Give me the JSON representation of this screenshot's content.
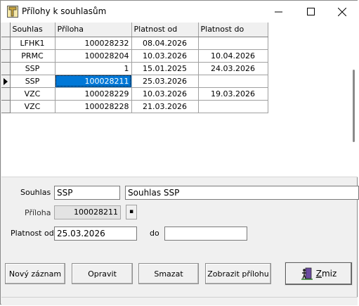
{
  "window": {
    "title": "Přílohy k souhlasům"
  },
  "grid": {
    "headers": [
      "Souhlas",
      "Příloha",
      "Platnost od",
      "Platnost do"
    ],
    "rows": [
      {
        "souhlas": "LFHK1",
        "priloha": "100028232",
        "od": "08.04.2026",
        "do": ""
      },
      {
        "souhlas": "PRMC",
        "priloha": "100028204",
        "od": "10.03.2026",
        "do": "10.04.2026"
      },
      {
        "souhlas": "SSP",
        "priloha": "1",
        "od": "15.01.2025",
        "do": "24.03.2026"
      },
      {
        "souhlas": "SSP",
        "priloha": "100028211",
        "od": "25.03.2026",
        "do": ""
      },
      {
        "souhlas": "VZC",
        "priloha": "100028229",
        "od": "10.03.2026",
        "do": "19.03.2026"
      },
      {
        "souhlas": "VZC",
        "priloha": "100028228",
        "od": "21.03.2026",
        "do": ""
      }
    ]
  },
  "form": {
    "souhlas_label": "Souhlas",
    "souhlas_code": "SSP",
    "souhlas_name": "Souhlas SSP",
    "priloha_label": "Příloha",
    "priloha_value": "100028211",
    "platnost_od_label": "Platnost od",
    "platnost_od_value": "25.03.2026",
    "do_label": "do",
    "do_value": ""
  },
  "buttons": {
    "new": "Nový záznam",
    "edit": "Opravit",
    "delete": "Smazat",
    "show": "Zobrazit přílohu",
    "close": "Zmiz"
  },
  "colors": {
    "selection": "#0078d7"
  }
}
